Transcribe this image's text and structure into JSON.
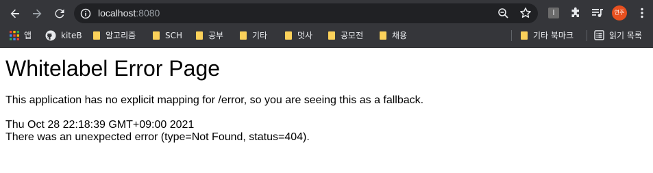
{
  "browser": {
    "url_host": "localhost",
    "url_port": ":8080",
    "profile_initials": "연주",
    "extension_letter": "I"
  },
  "bookmarks": {
    "items": [
      {
        "label": "앱",
        "icon": "apps-grid-icon"
      },
      {
        "label": "kiteB",
        "icon": "github-icon"
      },
      {
        "label": "알고리즘",
        "icon": "folder-icon"
      },
      {
        "label": "SCH",
        "icon": "folder-icon"
      },
      {
        "label": "공부",
        "icon": "folder-icon"
      },
      {
        "label": "기타",
        "icon": "folder-icon"
      },
      {
        "label": "멋사",
        "icon": "folder-icon"
      },
      {
        "label": "공모전",
        "icon": "folder-icon"
      },
      {
        "label": "채용",
        "icon": "folder-icon"
      }
    ],
    "other_bookmarks": "기타 북마크",
    "reading_list": "읽기 목록"
  },
  "page": {
    "title": "Whitelabel Error Page",
    "message": "This application has no explicit mapping for /error, so you are seeing this as a fallback.",
    "timestamp": "Thu Oct 28 22:18:39 GMT+09:00 2021",
    "error_detail": "There was an unexpected error (type=Not Found, status=404)."
  },
  "colors": {
    "toolbar_bg": "#35363a",
    "omnibox_bg": "#202124",
    "folder": "#fbd15a",
    "profile": "#e8501f"
  }
}
